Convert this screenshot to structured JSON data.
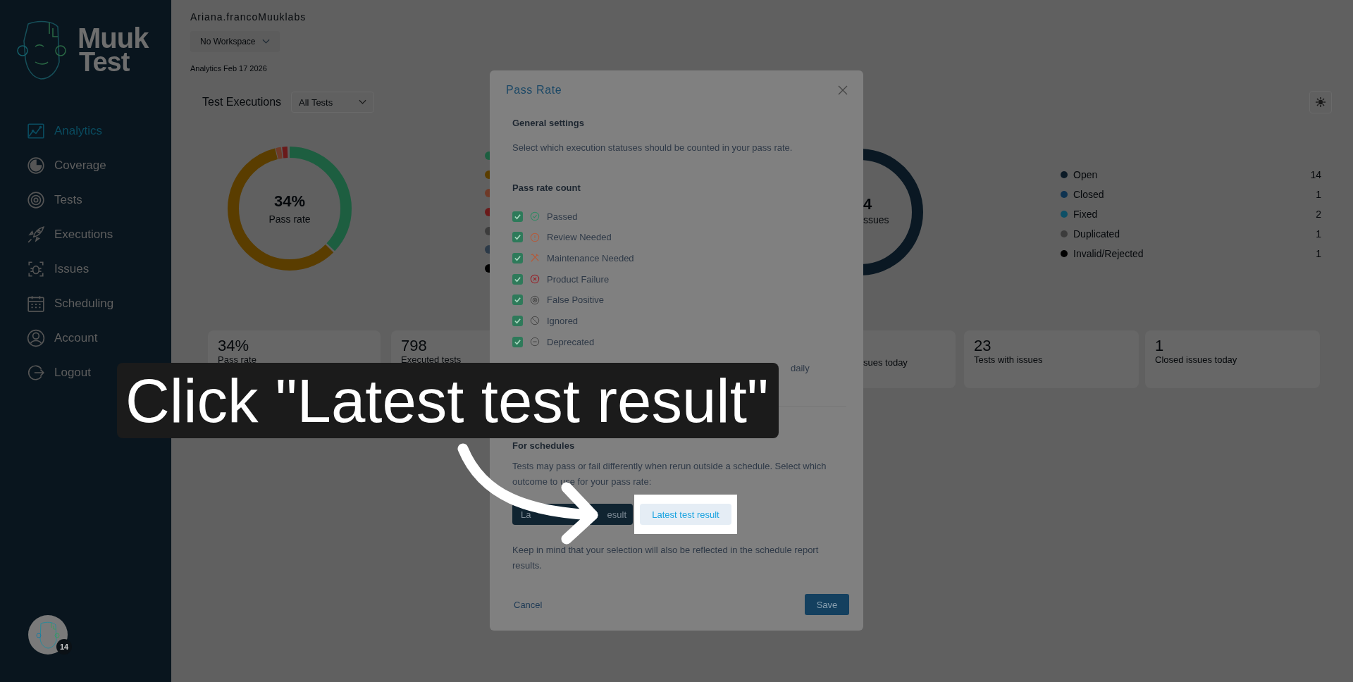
{
  "sidebar": {
    "logo": {
      "line_1": "Muuk",
      "line_2": "Test"
    },
    "items": [
      {
        "label": "Analytics",
        "selected": true
      },
      {
        "label": "Coverage",
        "selected": false
      },
      {
        "label": "Tests",
        "selected": false
      },
      {
        "label": "Executions",
        "selected": false
      },
      {
        "label": "Issues",
        "selected": false
      },
      {
        "label": "Scheduling",
        "selected": false
      },
      {
        "label": "Account",
        "selected": false
      },
      {
        "label": "Logout",
        "selected": false
      }
    ],
    "avatar_badge": "14"
  },
  "header": {
    "user": "Ariana.francoMuuklabs",
    "workspace": "No Workspace",
    "date": "Analytics Feb 17 2026"
  },
  "test_executions": {
    "title": "Test Executions",
    "filter": "All Tests",
    "pass_rate": "34%",
    "pass_rate_label": "Pass rate",
    "legend": [
      {
        "color": "#1d5e40"
      },
      {
        "color": "#5a3d00"
      },
      {
        "color": "#6e3a28"
      },
      {
        "color": "#6a1a1a"
      },
      {
        "color": "#3c3c3c"
      },
      {
        "color": "#2c3a48"
      },
      {
        "color": "#000000"
      }
    ]
  },
  "issues": {
    "count": "4",
    "label": "ssues",
    "legend": [
      {
        "label": "Open",
        "count": "14",
        "color": "#0b1a26"
      },
      {
        "label": "Closed",
        "count": "1",
        "color": "#0f3350"
      },
      {
        "label": "Fixed",
        "count": "2",
        "color": "#0d4f66"
      },
      {
        "label": "Duplicated",
        "count": "1",
        "color": "#3c3c3c"
      },
      {
        "label": "Invalid/Rejected",
        "count": "1",
        "color": "#000000"
      }
    ]
  },
  "stats": [
    {
      "kind": "full",
      "value": "34%",
      "label": "Pass rate"
    },
    {
      "kind": "full",
      "value": "798",
      "label": "Executed tests"
    },
    {
      "kind": "partial",
      "label": "sues today"
    },
    {
      "kind": "full",
      "value": "23",
      "label": "Tests with issues"
    },
    {
      "kind": "full",
      "value": "1",
      "label": "Closed issues today"
    }
  ],
  "modal": {
    "title": "Pass Rate",
    "general_heading": "General settings",
    "general_text": "Select which execution statuses should be counted in your pass rate.",
    "count_heading": "Pass rate count",
    "statuses": [
      {
        "label": "Passed",
        "checked": true
      },
      {
        "label": "Review Needed",
        "checked": true
      },
      {
        "label": "Maintenance Needed",
        "checked": true
      },
      {
        "label": "Product Failure",
        "checked": true
      },
      {
        "label": "False Positive",
        "checked": true
      },
      {
        "label": "Ignored",
        "checked": true
      },
      {
        "label": "Deprecated",
        "checked": true
      }
    ],
    "daily_note_visible": "daily",
    "schedules_heading": "For schedules",
    "schedules_text": "Tests may pass or fail differently when rerun outside a schedule. Select which outcome to use for your pass rate:",
    "schedule_options": [
      {
        "label_parts": [
          "La",
          "esult"
        ],
        "selected": true,
        "highlighted": false
      },
      {
        "label": "Latest test result",
        "selected": false,
        "highlighted": true
      }
    ],
    "schedules_note": "Keep in mind that your selection will also be reflected in the schedule report results.",
    "cancel": "Cancel",
    "save": "Save"
  },
  "tutorial": {
    "callout": "Click \"Latest test result\""
  }
}
